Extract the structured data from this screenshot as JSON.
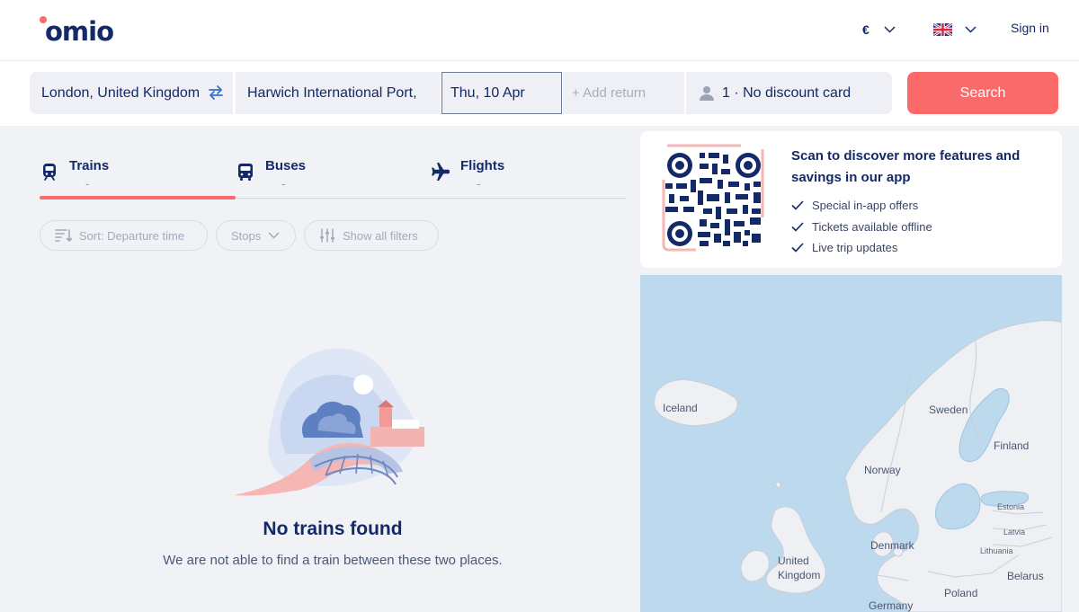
{
  "header": {
    "logo_text": "omio",
    "currency": "€",
    "language_icon": "uk-flag-icon",
    "signin_label": "Sign in"
  },
  "search": {
    "from": "London, United Kingdom",
    "to": "Harwich International Port,",
    "date": "Thu, 10 Apr",
    "return_placeholder": "+ Add return",
    "passengers": "1 · No discount card",
    "button_label": "Search"
  },
  "tabs": [
    {
      "label": "Trains",
      "sub": "-",
      "icon": "train-icon",
      "active": true
    },
    {
      "label": "Buses",
      "sub": "-",
      "icon": "bus-icon",
      "active": false
    },
    {
      "label": "Flights",
      "sub": "-",
      "icon": "plane-icon",
      "active": false
    }
  ],
  "filters": {
    "sort_label": "Sort: Departure time",
    "stops_label": "Stops",
    "all_filters_label": "Show all filters"
  },
  "empty_state": {
    "title": "No trains found",
    "description": "We are not able to find a train between these two places."
  },
  "app_promo": {
    "title": "Scan to discover more features and savings in our app",
    "perks": [
      "Special in-app offers",
      "Tickets available offline",
      "Live trip updates"
    ]
  },
  "map": {
    "labels": [
      "Iceland",
      "Sweden",
      "Finland",
      "Norway",
      "Estonia",
      "Latvia",
      "Lithuania",
      "United Kingdom",
      "Denmark",
      "Belarus",
      "Poland",
      "Germany"
    ]
  },
  "colors": {
    "brand_navy": "#132968",
    "accent_coral": "#fa6a6a",
    "background": "#f1f2f6",
    "sea": "#bcd9ee"
  }
}
